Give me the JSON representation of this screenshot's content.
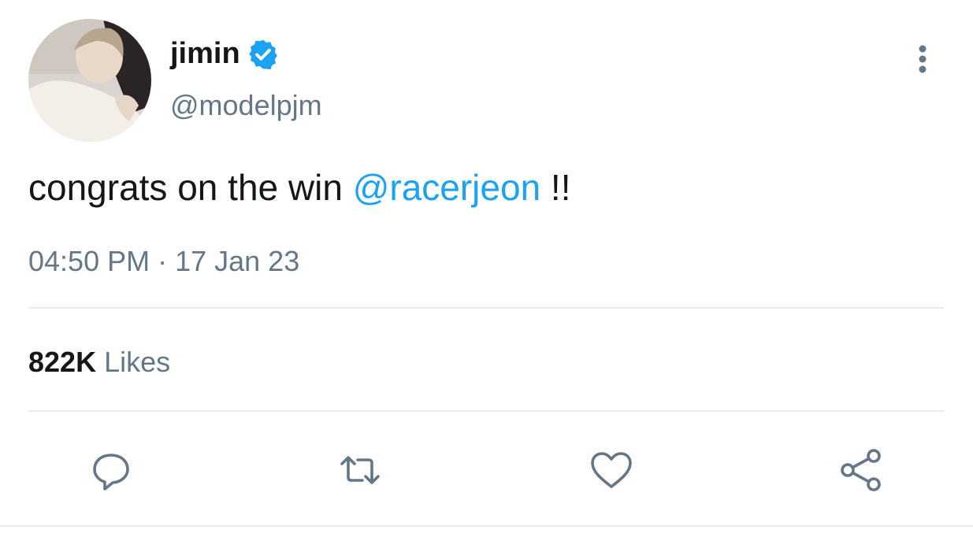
{
  "tweet": {
    "author": {
      "display_name": "jimin",
      "handle": "@modelpjm",
      "verified": true,
      "avatar_icon": "profile-photo"
    },
    "text_before": "congrats on the win ",
    "mention": "@racerjeon",
    "text_after": " !!",
    "time": "04:50 PM",
    "separator": " · ",
    "date": "17 Jan 23",
    "likes_count": "822K",
    "likes_label": "Likes"
  },
  "actions": [
    {
      "name": "reply",
      "icon": "comment-icon"
    },
    {
      "name": "retweet",
      "icon": "retweet-icon"
    },
    {
      "name": "like",
      "icon": "heart-icon"
    },
    {
      "name": "share",
      "icon": "share-icon"
    }
  ],
  "menu": {
    "icon": "more-vertical-icon"
  },
  "colors": {
    "text": "#14171a",
    "secondary": "#657786",
    "accent": "#1da1f2",
    "divider": "#e6ecf0"
  }
}
